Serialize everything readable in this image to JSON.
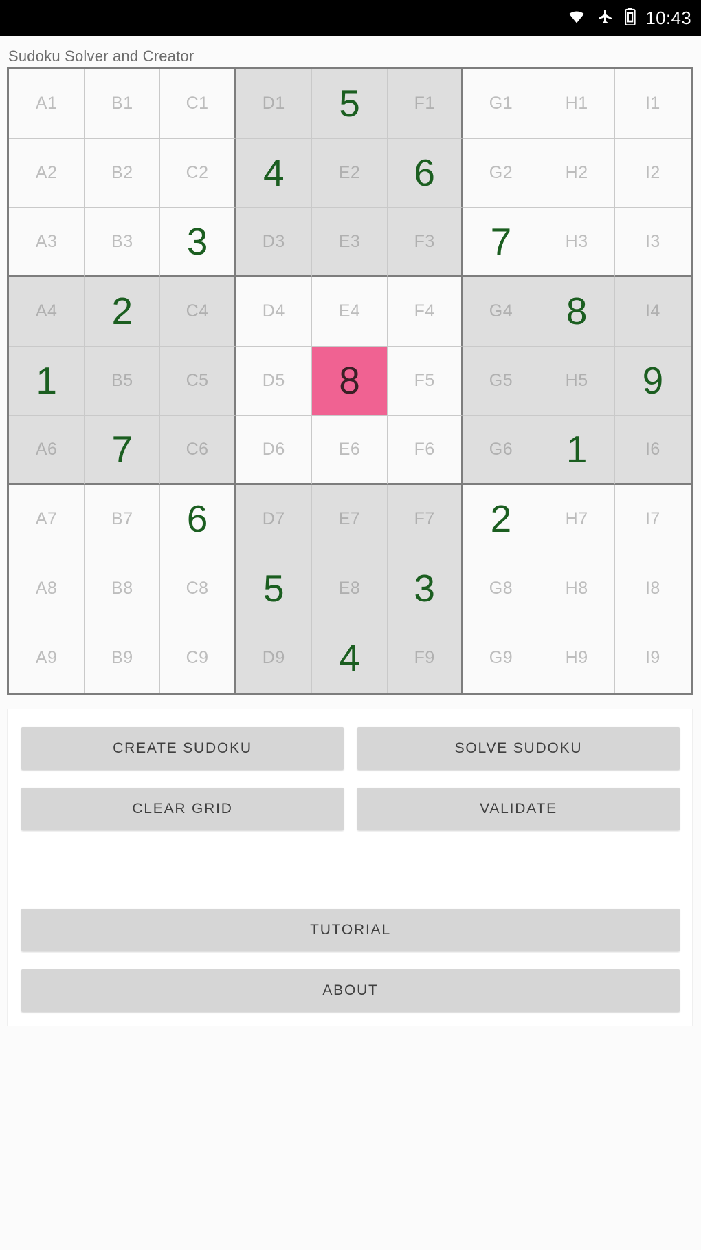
{
  "status_bar": {
    "icons": [
      "wifi-icon",
      "airplane-mode-icon",
      "battery-icon"
    ],
    "clock": "10:43"
  },
  "app": {
    "title": "Sudoku Solver and Creator"
  },
  "grid": {
    "columns": [
      "A",
      "B",
      "C",
      "D",
      "E",
      "F",
      "G",
      "H",
      "I"
    ],
    "rows": [
      "1",
      "2",
      "3",
      "4",
      "5",
      "6",
      "7",
      "8",
      "9"
    ],
    "selected_cell": "E5",
    "selected_color": "#f06292",
    "value_color": "#1b5e20",
    "label_color": "#bdbdbd",
    "shaded_box_color": "#dedede",
    "plain_box_color": "#fafafa",
    "cells": [
      [
        {
          "id": "A1",
          "value": ""
        },
        {
          "id": "B1",
          "value": ""
        },
        {
          "id": "C1",
          "value": ""
        },
        {
          "id": "D1",
          "value": ""
        },
        {
          "id": "E1",
          "value": "5"
        },
        {
          "id": "F1",
          "value": ""
        },
        {
          "id": "G1",
          "value": ""
        },
        {
          "id": "H1",
          "value": ""
        },
        {
          "id": "I1",
          "value": ""
        }
      ],
      [
        {
          "id": "A2",
          "value": ""
        },
        {
          "id": "B2",
          "value": ""
        },
        {
          "id": "C2",
          "value": ""
        },
        {
          "id": "D2",
          "value": "4"
        },
        {
          "id": "E2",
          "value": ""
        },
        {
          "id": "F2",
          "value": "6"
        },
        {
          "id": "G2",
          "value": ""
        },
        {
          "id": "H2",
          "value": ""
        },
        {
          "id": "I2",
          "value": ""
        }
      ],
      [
        {
          "id": "A3",
          "value": ""
        },
        {
          "id": "B3",
          "value": ""
        },
        {
          "id": "C3",
          "value": "3"
        },
        {
          "id": "D3",
          "value": ""
        },
        {
          "id": "E3",
          "value": ""
        },
        {
          "id": "F3",
          "value": ""
        },
        {
          "id": "G3",
          "value": "7"
        },
        {
          "id": "H3",
          "value": ""
        },
        {
          "id": "I3",
          "value": ""
        }
      ],
      [
        {
          "id": "A4",
          "value": ""
        },
        {
          "id": "B4",
          "value": "2"
        },
        {
          "id": "C4",
          "value": ""
        },
        {
          "id": "D4",
          "value": ""
        },
        {
          "id": "E4",
          "value": ""
        },
        {
          "id": "F4",
          "value": ""
        },
        {
          "id": "G4",
          "value": ""
        },
        {
          "id": "H4",
          "value": "8"
        },
        {
          "id": "I4",
          "value": ""
        }
      ],
      [
        {
          "id": "A5",
          "value": "1"
        },
        {
          "id": "B5",
          "value": ""
        },
        {
          "id": "C5",
          "value": ""
        },
        {
          "id": "D5",
          "value": ""
        },
        {
          "id": "E5",
          "value": "8"
        },
        {
          "id": "F5",
          "value": ""
        },
        {
          "id": "G5",
          "value": ""
        },
        {
          "id": "H5",
          "value": ""
        },
        {
          "id": "I5",
          "value": "9"
        }
      ],
      [
        {
          "id": "A6",
          "value": ""
        },
        {
          "id": "B6",
          "value": "7"
        },
        {
          "id": "C6",
          "value": ""
        },
        {
          "id": "D6",
          "value": ""
        },
        {
          "id": "E6",
          "value": ""
        },
        {
          "id": "F6",
          "value": ""
        },
        {
          "id": "G6",
          "value": ""
        },
        {
          "id": "H6",
          "value": "1"
        },
        {
          "id": "I6",
          "value": ""
        }
      ],
      [
        {
          "id": "A7",
          "value": ""
        },
        {
          "id": "B7",
          "value": ""
        },
        {
          "id": "C7",
          "value": "6"
        },
        {
          "id": "D7",
          "value": ""
        },
        {
          "id": "E7",
          "value": ""
        },
        {
          "id": "F7",
          "value": ""
        },
        {
          "id": "G7",
          "value": "2"
        },
        {
          "id": "H7",
          "value": ""
        },
        {
          "id": "I7",
          "value": ""
        }
      ],
      [
        {
          "id": "A8",
          "value": ""
        },
        {
          "id": "B8",
          "value": ""
        },
        {
          "id": "C8",
          "value": ""
        },
        {
          "id": "D8",
          "value": "5"
        },
        {
          "id": "E8",
          "value": ""
        },
        {
          "id": "F8",
          "value": "3"
        },
        {
          "id": "G8",
          "value": ""
        },
        {
          "id": "H8",
          "value": ""
        },
        {
          "id": "I8",
          "value": ""
        }
      ],
      [
        {
          "id": "A9",
          "value": ""
        },
        {
          "id": "B9",
          "value": ""
        },
        {
          "id": "C9",
          "value": ""
        },
        {
          "id": "D9",
          "value": ""
        },
        {
          "id": "E9",
          "value": "4"
        },
        {
          "id": "F9",
          "value": ""
        },
        {
          "id": "G9",
          "value": ""
        },
        {
          "id": "H9",
          "value": ""
        },
        {
          "id": "I9",
          "value": ""
        }
      ]
    ]
  },
  "controls": {
    "create_sudoku": "CREATE SUDOKU",
    "solve_sudoku": "SOLVE SUDOKU",
    "clear_grid": "CLEAR GRID",
    "validate": "VALIDATE",
    "tutorial": "TUTORIAL",
    "about": "ABOUT"
  }
}
